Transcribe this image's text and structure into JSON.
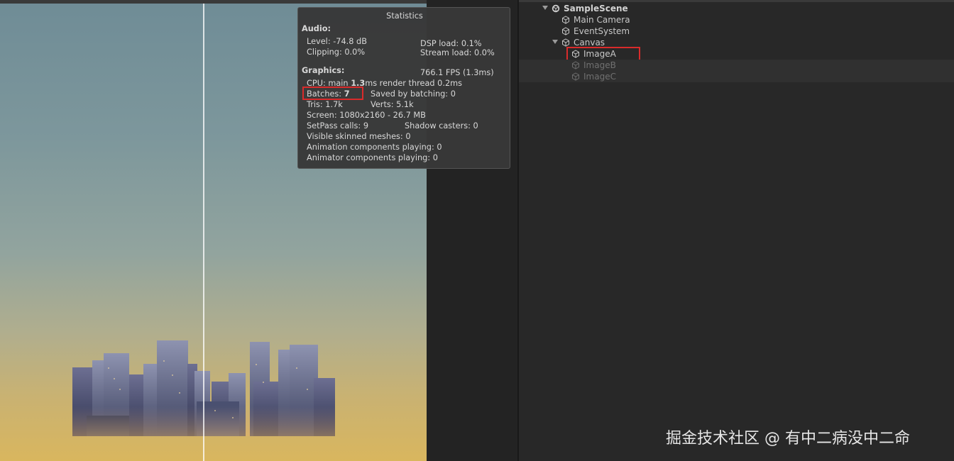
{
  "statistics": {
    "title": "Statistics",
    "audio_header": "Audio:",
    "level": "Level: -74.8 dB",
    "dsp_load": "DSP load: 0.1%",
    "clipping": "Clipping: 0.0%",
    "stream_load": "Stream load: 0.0%",
    "graphics_header": "Graphics:",
    "fps": "766.1 FPS (1.3ms)",
    "cpu_prefix": "CPU: main ",
    "cpu_main": "1.3",
    "cpu_suffix": "ms  render thread 0.2ms",
    "batches_label": "Batches: ",
    "batches_value": "7",
    "saved_by_batching": "Saved by batching: 0",
    "tris": "Tris: 1.7k",
    "verts": "Verts: 5.1k",
    "screen": "Screen: 1080x2160 - 26.7 MB",
    "setpass": "SetPass calls: 9",
    "shadow_casters": "Shadow casters: 0",
    "skinned_meshes": "Visible skinned meshes: 0",
    "animation_components": "Animation components playing: 0",
    "animator_components": "Animator components playing: 0"
  },
  "hierarchy": {
    "scene": "SampleScene",
    "items": [
      {
        "label": "Main Camera"
      },
      {
        "label": "EventSystem"
      },
      {
        "label": "Canvas"
      },
      {
        "label": "ImageA"
      },
      {
        "label": "ImageB"
      },
      {
        "label": "ImageC"
      }
    ]
  },
  "watermark": "掘金技术社区 @ 有中二病没中二命",
  "colors": {
    "highlight_box": "#d92b2b",
    "panel_bg": "#383838",
    "editor_bg": "#282828"
  }
}
